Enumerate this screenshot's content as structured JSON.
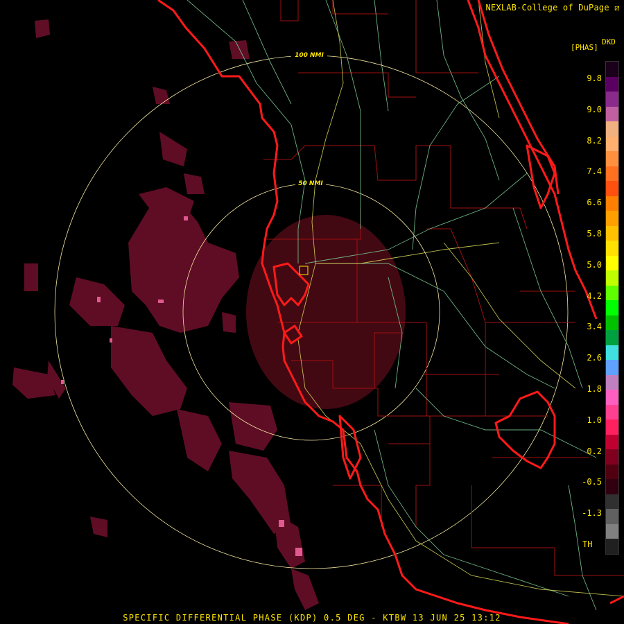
{
  "credit": "NEXLAB-College of DuPage ⧄",
  "legend": {
    "units": "[PHAS]",
    "product": "DKD",
    "ticks": [
      "9.8",
      "9.0",
      "8.2",
      "7.4",
      "6.6",
      "5.8",
      "5.0",
      "4.2",
      "3.4",
      "2.6",
      "1.8",
      "1.0",
      "0.2",
      "-0.5",
      "-1.3",
      "TH"
    ],
    "colors": [
      "#1a001a",
      "#5a0060",
      "#8a2a8a",
      "#c060a0",
      "#f0b080",
      "#ffb070",
      "#ff9040",
      "#ff7020",
      "#ff5010",
      "#ff8000",
      "#ffa000",
      "#ffc000",
      "#ffe000",
      "#ffff00",
      "#c0ff00",
      "#60ff00",
      "#00ff00",
      "#00c000",
      "#00a040",
      "#40e0e0",
      "#60a0ff",
      "#c080c0",
      "#ff60c0",
      "#ff4090",
      "#ff2060",
      "#c00030",
      "#800020",
      "#500010",
      "#300010",
      "#303030",
      "#606060",
      "#808080",
      "#202020"
    ]
  },
  "rings": {
    "inner_label": "50 NMI",
    "outer_label": "100 NMI"
  },
  "footer": "SPECIFIC DIFFERENTIAL PHASE (KDP) 0.5 DEG - KTBW 13 JUN 25 13:12"
}
